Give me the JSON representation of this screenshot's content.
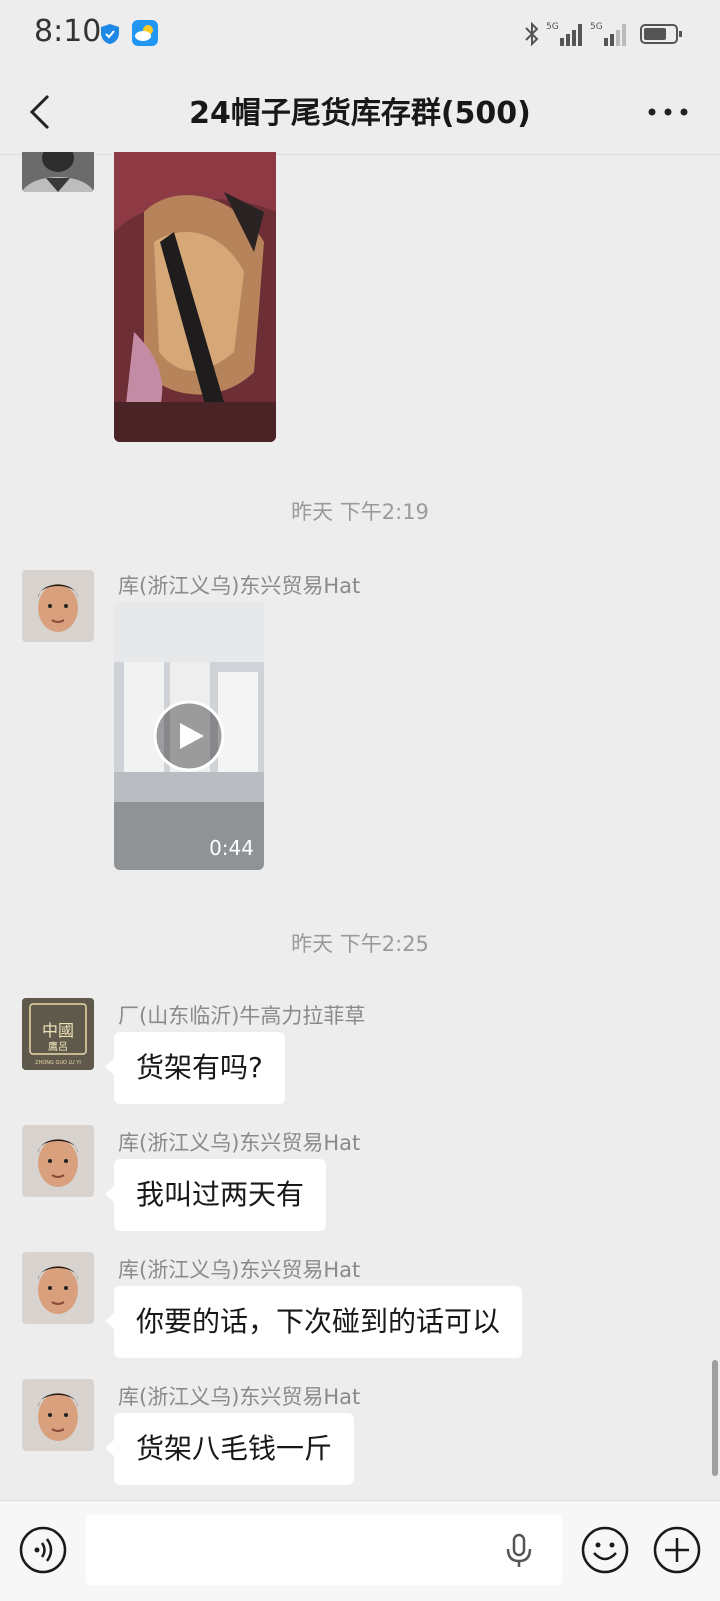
{
  "status_bar": {
    "time": "8:10",
    "network_1": "5G",
    "network_2": "5G"
  },
  "header": {
    "title": "24帽子尾货库存群(500)"
  },
  "messages": {
    "ts1": "昨天 下午2:19",
    "video_sender": "库(浙江义乌)东兴贸易Hat",
    "video_duration": "0:44",
    "ts2": "昨天 下午2:25",
    "m1_sender": "厂(山东临沂)牛高力拉菲草",
    "m1_text": "货架有吗?",
    "m2_sender": "库(浙江义乌)东兴贸易Hat",
    "m2_text": "我叫过两天有",
    "m3_sender": "库(浙江义乌)东兴贸易Hat",
    "m3_text": "你要的话，下次碰到的话可以",
    "m4_sender": "库(浙江义乌)东兴贸易Hat",
    "m4_text": "货架八毛钱一斤"
  },
  "seal_text": "中國 鷹呂",
  "seal_caption": "ZHONG GUO LU YI",
  "colors": {
    "background": "#ededed",
    "bubble": "#ffffff",
    "accent_blue": "#1a73e8"
  }
}
